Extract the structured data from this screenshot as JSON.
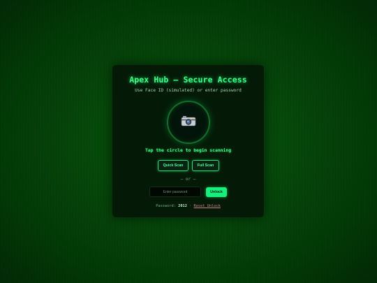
{
  "app": {
    "title": "Apex Hub — Secure Access",
    "subtitle": "Use Face ID (simulated) or enter password"
  },
  "face_id": {
    "icon": "camera-icon",
    "hint": "Tap the circle to begin scanning"
  },
  "scan_buttons": {
    "quick_label": "Quick Scan",
    "full_label": "Full Scan"
  },
  "divider": {
    "label": "— or —"
  },
  "password": {
    "placeholder": "Enter password",
    "value": "",
    "unlock_label": "Unlock"
  },
  "footer": {
    "password_label": "Password:",
    "password_value": "2012",
    "separator": "·",
    "reset_label": "Reset Unlock"
  },
  "colors": {
    "accent": "#3bff8a",
    "unlock_bg": "#18f07e",
    "card_bg": "#041a07"
  }
}
